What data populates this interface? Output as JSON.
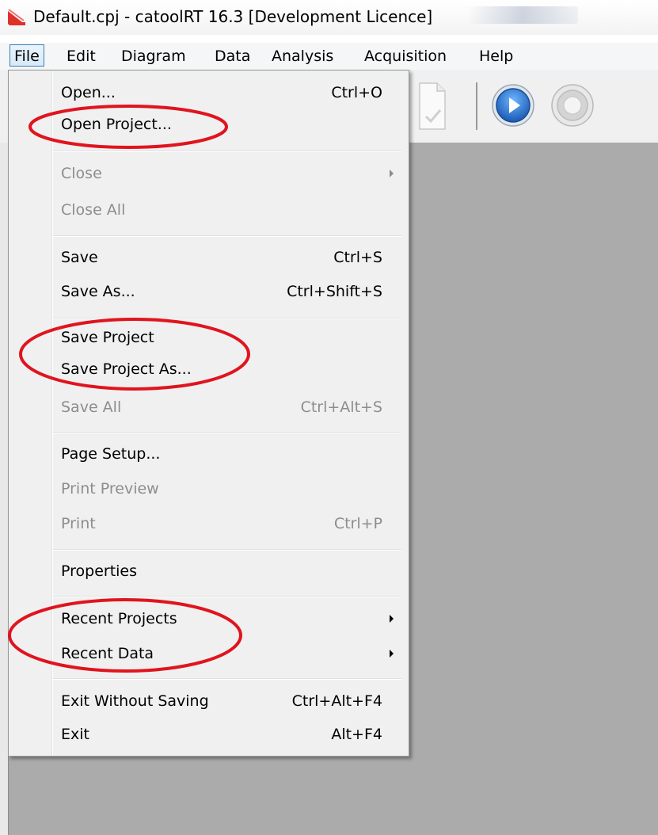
{
  "window": {
    "title": "Default.cpj - catoolRT 16.3 [Development Licence]",
    "app_icon": "catoolrt-app-icon"
  },
  "menubar": {
    "items": [
      "File",
      "Edit",
      "Diagram",
      "Data",
      "Analysis",
      "Acquisition",
      "Help"
    ],
    "active": "File"
  },
  "toolbar": {
    "icons": [
      "document-check-icon",
      "play-icon",
      "record-icon"
    ]
  },
  "file_menu": {
    "open": {
      "label": "Open...",
      "shortcut": "Ctrl+O"
    },
    "open_project": {
      "label": "Open Project..."
    },
    "close": {
      "label": "Close"
    },
    "close_all": {
      "label": "Close All"
    },
    "save": {
      "label": "Save",
      "shortcut": "Ctrl+S"
    },
    "save_as": {
      "label": "Save As...",
      "shortcut": "Ctrl+Shift+S"
    },
    "save_project": {
      "label": "Save Project"
    },
    "save_project_as": {
      "label": "Save Project As..."
    },
    "save_all": {
      "label": "Save All",
      "shortcut": "Ctrl+Alt+S"
    },
    "page_setup": {
      "label": "Page Setup..."
    },
    "print_preview": {
      "label": "Print Preview"
    },
    "print": {
      "label": "Print",
      "shortcut": "Ctrl+P"
    },
    "properties": {
      "label": "Properties"
    },
    "recent_projects": {
      "label": "Recent Projects"
    },
    "recent_data": {
      "label": "Recent Data"
    },
    "exit_without_saving": {
      "label": "Exit Without Saving",
      "shortcut": "Ctrl+Alt+F4"
    },
    "exit": {
      "label": "Exit",
      "shortcut": "Alt+F4"
    }
  },
  "colors": {
    "annotation": "#e0141e",
    "menu_background": "#f0f0f0",
    "workspace": "#ababab",
    "disabled_text": "#8d8d8d"
  }
}
